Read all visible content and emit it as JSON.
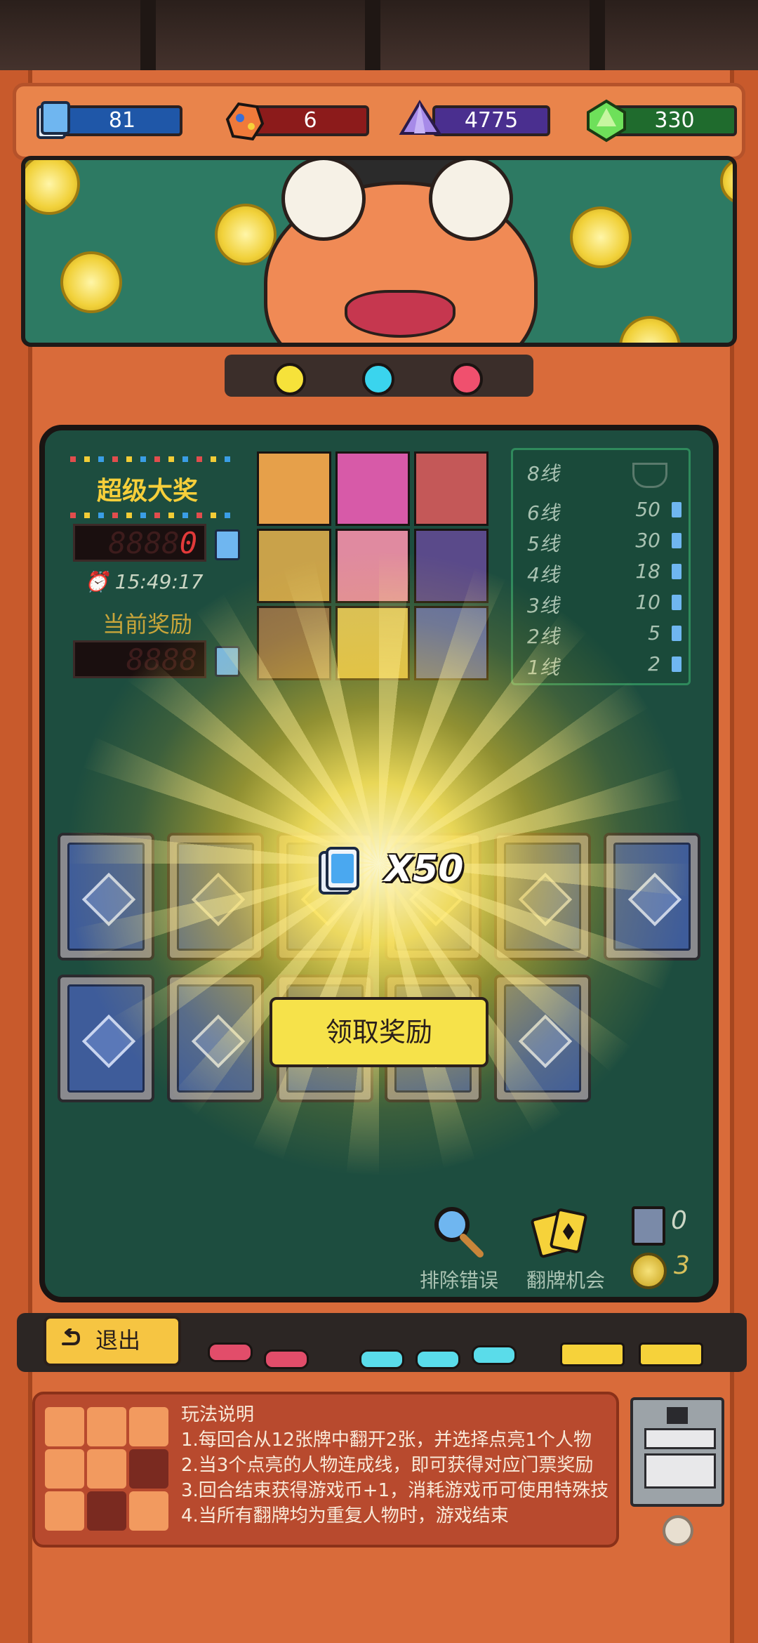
{
  "resources": {
    "tickets": "81",
    "ore": "6",
    "crystal": "4775",
    "gem": "330"
  },
  "jackpot": {
    "title": "超级大奖",
    "display_ghost": "8888",
    "display_value": "0",
    "timer": "15:49:17",
    "current_title": "当前奖励",
    "current_ghost": "8888"
  },
  "lines": [
    {
      "label": "8线",
      "value": ""
    },
    {
      "label": "6线",
      "value": "50"
    },
    {
      "label": "5线",
      "value": "30"
    },
    {
      "label": "4线",
      "value": "18"
    },
    {
      "label": "3线",
      "value": "10"
    },
    {
      "label": "2线",
      "value": "5"
    },
    {
      "label": "1线",
      "value": "2"
    }
  ],
  "reward": {
    "text": "X50",
    "claim_label": "领取奖励"
  },
  "tools": {
    "eliminate_label": "排除错误",
    "flip_label": "翻牌机会",
    "chips_count": "0",
    "coins_count": "3"
  },
  "controls": {
    "exit_label": "退出"
  },
  "instructions": {
    "title": "玩法说明",
    "lines": [
      "1.每回合从12张牌中翻开2张，并选择点亮1个人物",
      "2.当3个点亮的人物连成线，即可获得对应门票奖励",
      "3.回合结束获得游戏币+1，消耗游戏币可使用特殊技",
      "4.当所有翻牌均为重复人物时，游戏结束"
    ]
  },
  "colors": {
    "ticket_bar": "#1f57a8",
    "ore_bar": "#8c1b1b",
    "crystal_bar": "#4a2f8f",
    "gem_bar": "#1f6b2d",
    "claim_button": "#f6e24a"
  }
}
